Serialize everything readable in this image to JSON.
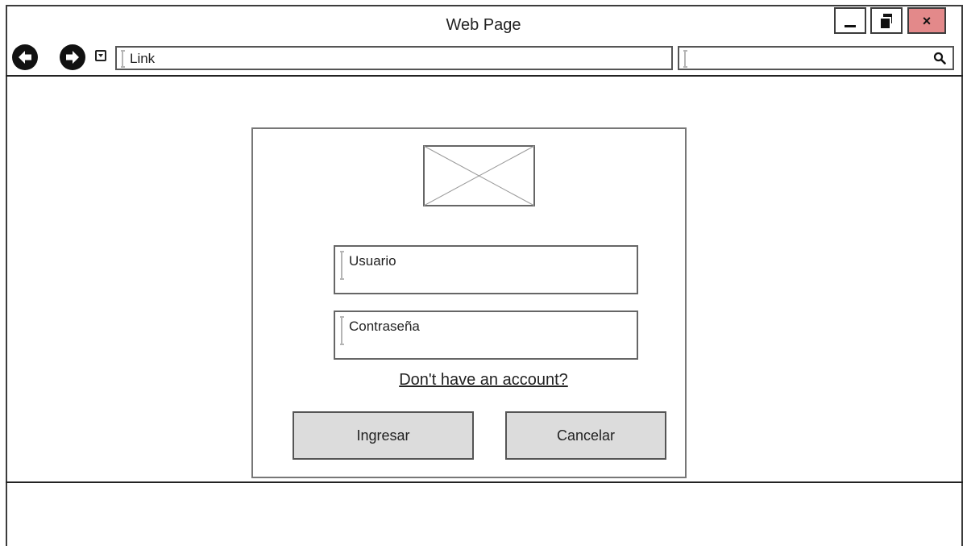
{
  "window": {
    "title": "Web Page",
    "controls": {
      "minimize": "minimize-icon",
      "maximize": "restore-icon",
      "close": "×"
    }
  },
  "toolbar": {
    "url": "Link",
    "search_value": "",
    "icons": [
      "arrow-left-icon",
      "arrow-right-icon",
      "dropdown-icon",
      "search-icon"
    ]
  },
  "login": {
    "image_placeholder": "image-placeholder",
    "username_field": "Usuario",
    "password_field": "Contraseña",
    "signup_link": "Don't have an account?",
    "submit_label": "Ingresar",
    "cancel_label": "Cancelar"
  },
  "colors": {
    "close_button": "#e3898a",
    "button_fill": "#dcdcdc",
    "border": "#3c3c3c"
  }
}
